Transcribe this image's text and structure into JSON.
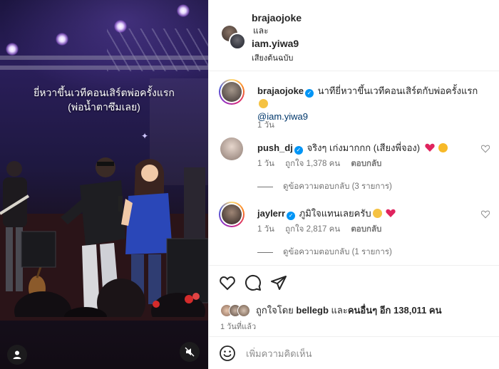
{
  "header": {
    "owner_username": "brajaojoke",
    "conjunction": "และ",
    "collab_username": "iam.yiwa9",
    "audio_label": "เสียงต้นฉบับ"
  },
  "media": {
    "caption_line1": "ยี่หวาขึ้นเวทีคอนเสิร์ตพ่อครั้งแรก",
    "caption_line2": "(พ่อน้ำตาซึมเลย)",
    "sparkle_glyph": "✦"
  },
  "post_caption": {
    "username": "brajaojoke",
    "text": "นาทียี่หวาขึ้นเวทีคอนเสิร์ตกับพ่อครั้งแรก",
    "mention": "@iam.yiwa9",
    "time": "1 วัน"
  },
  "comments": [
    {
      "username": "push_dj",
      "text": "จริงๆ เก่งมากกก (เสียงพี่จอง)",
      "time": "1 วัน",
      "likes": "ถูกใจ 1,378 คน",
      "reply_label": "ตอบกลับ",
      "view_replies": "ดูข้อความตอบกลับ (3 รายการ)"
    },
    {
      "username": "jaylerr",
      "text": "ภูมิใจแทนเลยครับ",
      "time": "1 วัน",
      "likes": "ถูกใจ 2,817 คน",
      "reply_label": "ตอบกลับ",
      "view_replies": "ดูข้อความตอบกลับ (1 รายการ)"
    }
  ],
  "actions": {
    "liked_by_prefix": "ถูกใจโดย",
    "liked_by_user": "bellegb",
    "liked_by_mid": "และ",
    "liked_by_others": "คนอื่นๆ",
    "liked_by_count": "อีก 138,011 คน",
    "posted_ago": "1 วันที่แล้ว"
  },
  "composer": {
    "placeholder": "เพิ่มความคิดเห็น"
  },
  "colors": {
    "verified": "#0095f6",
    "heart_red": "#ed4956",
    "meta_gray": "#737373",
    "mention_blue": "#00376b"
  },
  "icons": [
    "heart-icon",
    "comment-icon",
    "share-icon",
    "emoji-icon",
    "verified-icon",
    "user-tag-icon",
    "mute-icon"
  ]
}
